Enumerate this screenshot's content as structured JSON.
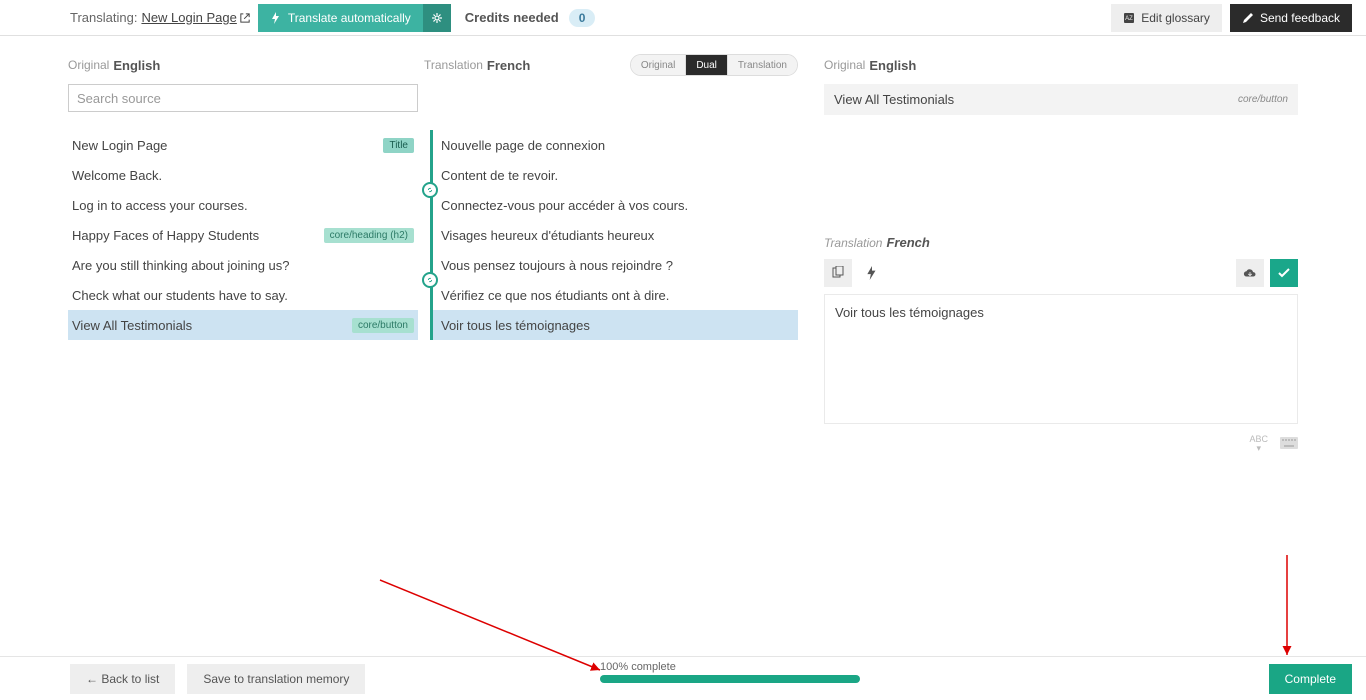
{
  "topbar": {
    "translating_label": "Translating:",
    "page_name": "New Login Page",
    "auto_label": "Translate automatically",
    "credits_label": "Credits needed",
    "credits_value": "0",
    "edit_glossary": "Edit glossary",
    "send_feedback": "Send feedback"
  },
  "left": {
    "label": "Original",
    "lang": "English",
    "search_placeholder": "Search source"
  },
  "mid": {
    "label": "Translation",
    "lang": "French",
    "toggle": {
      "original": "Original",
      "dual": "Dual",
      "translation": "Translation"
    }
  },
  "rows": [
    {
      "src": "New Login Page",
      "tag": "Title",
      "tag_cls": "tag-teal",
      "dst": "Nouvelle page de connexion"
    },
    {
      "src": "Welcome Back.",
      "dst": "Content de te revoir.",
      "link_after": true
    },
    {
      "src": "Log in to access your courses.",
      "dst": "Connectez-vous pour accéder à vos cours."
    },
    {
      "src": "Happy Faces of Happy Students",
      "tag": "core/heading (h2)",
      "tag_cls": "tag-green",
      "dst": "Visages heureux d'étudiants heureux"
    },
    {
      "src": "Are you still thinking about joining us?",
      "dst": "Vous pensez toujours à nous rejoindre ?",
      "link_after": true
    },
    {
      "src": "Check what our students have to say.",
      "dst": "Vérifiez ce que nos étudiants ont à dire."
    },
    {
      "src": "View All Testimonials",
      "tag": "core/button",
      "tag_cls": "tag-green",
      "dst": "Voir tous les témoignages",
      "selected": true
    }
  ],
  "right": {
    "orig_label": "Original",
    "orig_lang": "English",
    "orig_text": "View All Testimonials",
    "orig_badge": "core/button",
    "trans_label": "Translation",
    "trans_lang": "French",
    "trans_text": "Voir tous les témoignages"
  },
  "footer": {
    "back": "← Back to list",
    "save": "Save to translation memory",
    "progress_label": "100% complete",
    "complete": "Complete"
  }
}
